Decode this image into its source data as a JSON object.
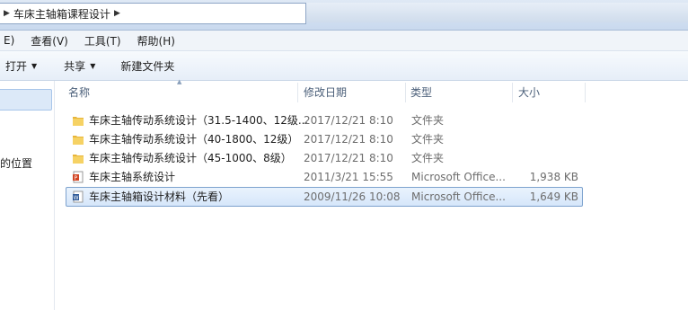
{
  "address": {
    "path": "车床主轴箱课程设计"
  },
  "menu": [
    "E)",
    "查看(V)",
    "工具(T)",
    "帮助(H)"
  ],
  "toolbar": {
    "open": "打开",
    "share": "共享",
    "new_folder": "新建文件夹"
  },
  "nav": {
    "partial_label": "的位置"
  },
  "columns": {
    "name": "名称",
    "date": "修改日期",
    "type": "类型",
    "size": "大小"
  },
  "files": [
    {
      "name": "车床主轴传动系统设计（31.5-1400、12级...",
      "date": "2017/12/21 8:10",
      "type": "文件夹",
      "size": "",
      "icon": "folder-icon"
    },
    {
      "name": "车床主轴传动系统设计（40-1800、12级）",
      "date": "2017/12/21 8:10",
      "type": "文件夹",
      "size": "",
      "icon": "folder-icon"
    },
    {
      "name": "车床主轴传动系统设计（45-1000、8级）",
      "date": "2017/12/21 8:10",
      "type": "文件夹",
      "size": "",
      "icon": "folder-icon"
    },
    {
      "name": "车床主轴系统设计",
      "date": "2011/3/21 15:55",
      "type": "Microsoft Office...",
      "size": "1,938 KB",
      "icon": "powerpoint-file-icon"
    },
    {
      "name": "车床主轴箱设计材料（先看）",
      "date": "2009/11/26 10:08",
      "type": "Microsoft Office...",
      "size": "1,649 KB",
      "icon": "word-file-icon"
    }
  ]
}
